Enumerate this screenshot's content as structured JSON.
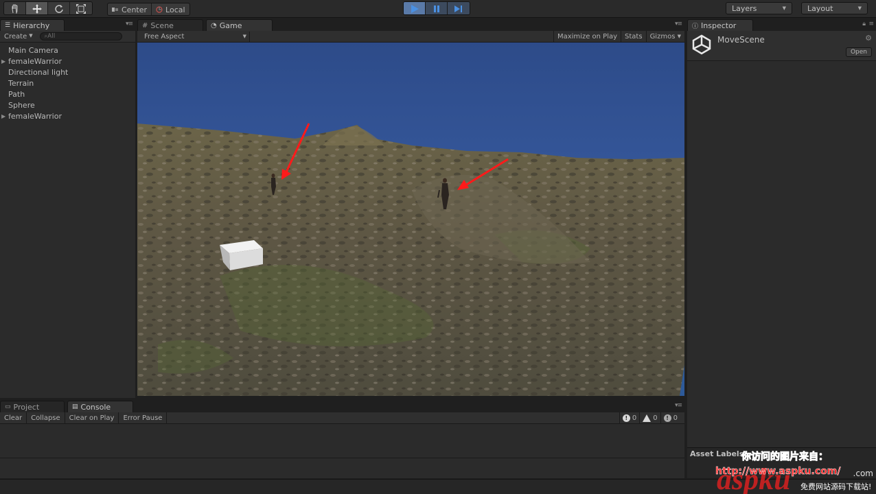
{
  "toolbar": {
    "tools": [
      {
        "name": "hand-tool",
        "icon": "hand-icon"
      },
      {
        "name": "move-tool",
        "icon": "move-arrows-icon"
      },
      {
        "name": "rotate-tool",
        "icon": "rotate-icon"
      },
      {
        "name": "scale-tool",
        "icon": "scale-icon"
      }
    ],
    "pivot_center_label": "Center",
    "pivot_local_label": "Local",
    "layers_label": "Layers",
    "layout_label": "Layout"
  },
  "hierarchy": {
    "tab_label": "Hierarchy",
    "create_label": "Create",
    "search_placeholder": "All",
    "items": [
      {
        "label": "Main Camera",
        "expandable": false
      },
      {
        "label": "femaleWarrior",
        "expandable": true
      },
      {
        "label": "Directional light",
        "expandable": false
      },
      {
        "label": "Terrain",
        "expandable": false
      },
      {
        "label": "Path",
        "expandable": false
      },
      {
        "label": "Sphere",
        "expandable": false
      },
      {
        "label": "femaleWarrior",
        "expandable": true
      }
    ]
  },
  "gameview": {
    "tabs": [
      "Scene",
      "Game"
    ],
    "aspect_label": "Free Aspect",
    "maximize_label": "Maximize on Play",
    "stats_label": "Stats",
    "gizmos_label": "Gizmos"
  },
  "inspector": {
    "tab_label": "Inspector",
    "asset_name": "MoveScene",
    "open_label": "Open",
    "asset_labels_title": "Asset Labels"
  },
  "console": {
    "tabs": [
      "Project",
      "Console"
    ],
    "buttons": [
      "Clear",
      "Collapse",
      "Clear on Play",
      "Error Pause"
    ],
    "counts": {
      "errors": "0",
      "warnings": "0",
      "messages": "0"
    }
  },
  "watermark": {
    "line1": "你访问的图片来自：",
    "line2": "http://www.aspku.com/",
    "brand": "aspku",
    "sub": "免费网站源码下载站!",
    "dot_com": ".com"
  },
  "colors": {
    "sky": "#2e4d8a",
    "terrain": "#5e5745",
    "play_accent": "#4a90e2",
    "arrow": "#ff1a1a"
  }
}
